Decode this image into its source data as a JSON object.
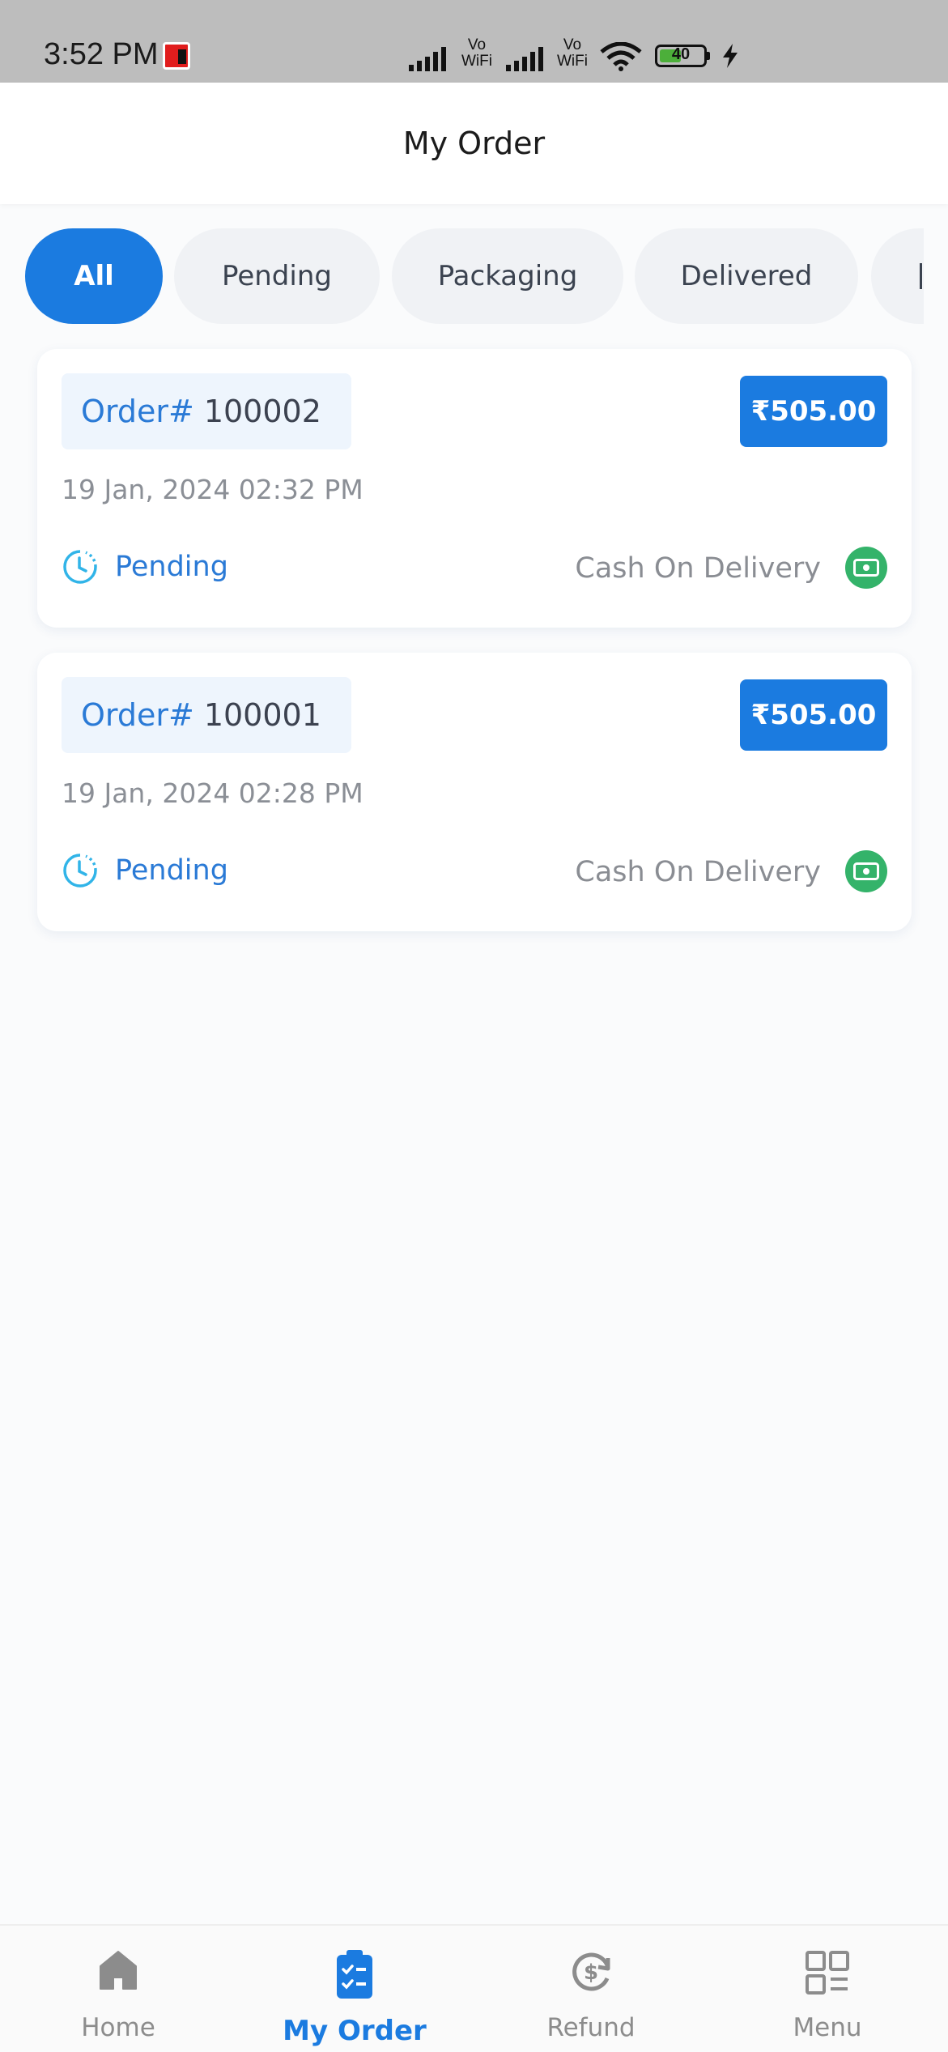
{
  "status_bar": {
    "time": "3:52 PM",
    "vowifi_1": "Vo WiFi",
    "vowifi_2": "Vo WiFi",
    "battery": "40"
  },
  "header": {
    "title": "My Order"
  },
  "tabs": [
    {
      "label": "All",
      "active": true
    },
    {
      "label": "Pending"
    },
    {
      "label": "Packaging"
    },
    {
      "label": "Delivered"
    }
  ],
  "orders": [
    {
      "prefix": "Order#",
      "id": "100002",
      "amount": "₹505.00",
      "date": "19 Jan, 2024 02:32 PM",
      "status": "Pending",
      "payment": "Cash On Delivery"
    },
    {
      "prefix": "Order#",
      "id": "100001",
      "amount": "₹505.00",
      "date": "19 Jan, 2024 02:28 PM",
      "status": "Pending",
      "payment": "Cash On Delivery"
    }
  ],
  "bottom_nav": [
    {
      "label": "Home",
      "icon": "home-icon"
    },
    {
      "label": "My Order",
      "icon": "clipboard-check-icon",
      "active": true
    },
    {
      "label": "Refund",
      "icon": "refund-icon"
    },
    {
      "label": "Menu",
      "icon": "grid-menu-icon"
    }
  ],
  "colors": {
    "accent": "#1b7be0",
    "tab_inactive": "#f0f2f5",
    "payment_icon": "#34b36a",
    "status_text": "#2a7ad6"
  }
}
